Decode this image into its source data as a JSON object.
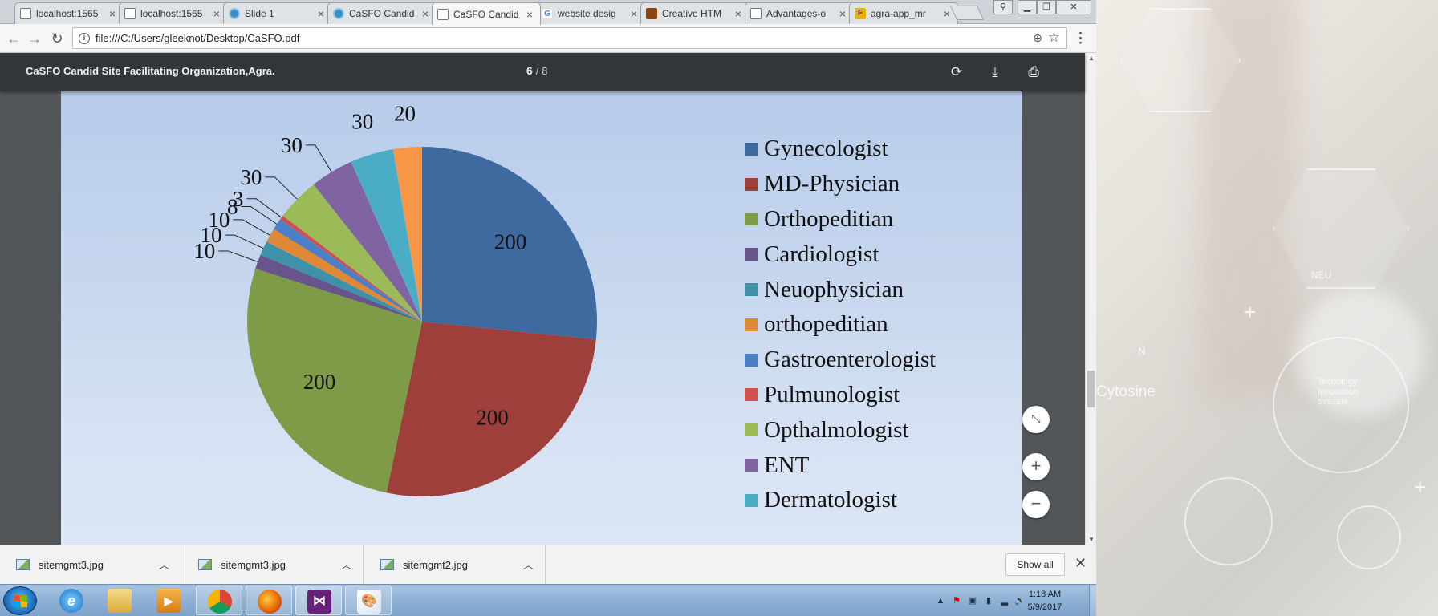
{
  "browser": {
    "tabs": [
      {
        "title": "localhost:1565",
        "favicon": "page-icon",
        "active": false
      },
      {
        "title": "localhost:1565",
        "favicon": "page-icon",
        "active": false
      },
      {
        "title": "Slide 1",
        "favicon": "circle-logo-icon",
        "active": false
      },
      {
        "title": "CaSFO Candid",
        "favicon": "circle-logo-icon",
        "active": false
      },
      {
        "title": "CaSFO Candid",
        "favicon": "page-icon",
        "active": true
      },
      {
        "title": "website desig",
        "favicon": "google-icon",
        "active": false
      },
      {
        "title": "Creative HTM",
        "favicon": "image-icon",
        "active": false
      },
      {
        "title": "Advantages-o",
        "favicon": "page-icon",
        "active": false
      },
      {
        "title": "agra-app_mr",
        "favicon": "f-logo-icon",
        "active": false
      }
    ],
    "url": "file:///C:/Users/gleeknot/Desktop/CaSFO.pdf"
  },
  "pdf": {
    "title": "CaSFO Candid Site Facilitating Organization,Agra.",
    "current_page": "6",
    "page_separator": "/",
    "total_pages": "8"
  },
  "chart_data": {
    "type": "pie",
    "start_angle_deg": 0,
    "direction": "clockwise",
    "slices": [
      {
        "label": "Gynecologist",
        "value": 200,
        "data_label": "200",
        "color": "#3f6aa0"
      },
      {
        "label": "MD-Physician",
        "value": 200,
        "data_label": "200",
        "color": "#9e3f3c"
      },
      {
        "label": "Orthopeditian",
        "value": 200,
        "data_label": "200",
        "color": "#7e9b47"
      },
      {
        "label": "Cardiologist",
        "value": 10,
        "data_label": "10",
        "color": "#66548a"
      },
      {
        "label": "Neuophysician",
        "value": 10,
        "data_label": "10",
        "color": "#3d91a8"
      },
      {
        "label": "orthopeditian",
        "value": 10,
        "data_label": "10",
        "color": "#df8838"
      },
      {
        "label": "Gastroenterologist",
        "value": 8,
        "data_label": "8",
        "color": "#4b7fc6"
      },
      {
        "label": "Pulmunologist",
        "value": 3,
        "data_label": "3",
        "color": "#d0504d"
      },
      {
        "label": "Opthalmologist",
        "value": 30,
        "data_label": "30",
        "color": "#9bbb59"
      },
      {
        "label": "ENT",
        "value": 30,
        "data_label": "30",
        "color": "#8064a2"
      },
      {
        "label": "Dermatologist",
        "value": 30,
        "data_label": "30",
        "color": "#4bacc6"
      },
      {
        "label": "",
        "value": 20,
        "data_label": "20",
        "color": "#f79646"
      }
    ],
    "legend_placement": "right"
  },
  "pdf_zoom": {
    "fit_label": "⤡",
    "zoom_in_label": "+",
    "zoom_out_label": "−"
  },
  "downloads": {
    "items": [
      {
        "name": "sitemgmt3.jpg"
      },
      {
        "name": "sitemgmt3.jpg"
      },
      {
        "name": "sitemgmt2.jpg"
      }
    ],
    "show_all": "Show all"
  },
  "taskbar": {
    "time": "1:18 AM",
    "date": "5/9/2017"
  },
  "wallpaper": {
    "words": [
      "Cytosine",
      "N",
      "NEU",
      "Tecnology",
      "Innovation",
      "SYSTEM"
    ]
  }
}
